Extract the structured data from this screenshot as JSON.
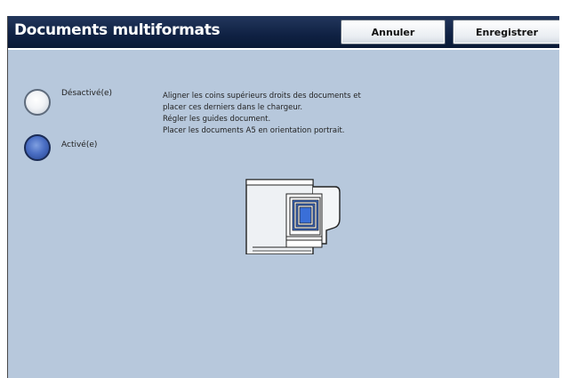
{
  "header": {
    "title": "Documents multiformats",
    "cancel_label": "Annuler",
    "save_label": "Enregistrer"
  },
  "options": {
    "off_label": "Désactivé(e)",
    "on_label": "Activé(e)",
    "selected": "on"
  },
  "instructions": {
    "lines": [
      "Aligner les coins supérieurs droits des documents et",
      "placer ces derniers dans le chargeur.",
      "Régler les guides document.",
      "Placer les documents A5 en orientation portrait."
    ]
  },
  "illustration": {
    "icon": "mixed-size-originals-feeder-icon"
  },
  "colors": {
    "title_bar": "#0f2143",
    "background": "#b7c8dc",
    "selected_radio": "#4b6fc4"
  }
}
